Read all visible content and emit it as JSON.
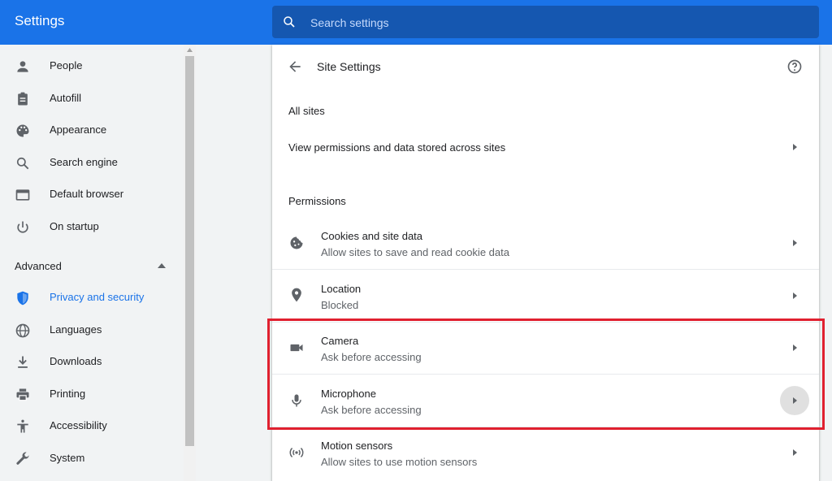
{
  "app": {
    "title": "Settings"
  },
  "search": {
    "placeholder": "Search settings"
  },
  "sidebar": {
    "items": [
      {
        "label": "People",
        "icon": "person-icon"
      },
      {
        "label": "Autofill",
        "icon": "clipboard-icon"
      },
      {
        "label": "Appearance",
        "icon": "palette-icon"
      },
      {
        "label": "Search engine",
        "icon": "search-icon"
      },
      {
        "label": "Default browser",
        "icon": "browser-window-icon"
      },
      {
        "label": "On startup",
        "icon": "power-icon"
      }
    ],
    "advanced_label": "Advanced",
    "advanced_items": [
      {
        "label": "Privacy and security",
        "icon": "shield-icon",
        "active": true
      },
      {
        "label": "Languages",
        "icon": "globe-icon"
      },
      {
        "label": "Downloads",
        "icon": "download-icon"
      },
      {
        "label": "Printing",
        "icon": "printer-icon"
      },
      {
        "label": "Accessibility",
        "icon": "accessibility-icon"
      },
      {
        "label": "System",
        "icon": "wrench-icon"
      }
    ]
  },
  "main": {
    "title": "Site Settings",
    "all_sites_header": "All sites",
    "all_sites_row": "View permissions and data stored across sites",
    "permissions_header": "Permissions",
    "permissions": [
      {
        "title": "Cookies and site data",
        "subtitle": "Allow sites to save and read cookie data",
        "icon": "cookie-icon"
      },
      {
        "title": "Location",
        "subtitle": "Blocked",
        "icon": "location-pin-icon"
      },
      {
        "title": "Camera",
        "subtitle": "Ask before accessing",
        "icon": "camera-icon"
      },
      {
        "title": "Microphone",
        "subtitle": "Ask before accessing",
        "icon": "microphone-icon"
      },
      {
        "title": "Motion sensors",
        "subtitle": "Allow sites to use motion sensors",
        "icon": "motion-sensors-icon"
      }
    ]
  },
  "colors": {
    "accent": "#1a73e8",
    "search_bg": "#1557b0",
    "highlight": "#e0202f"
  }
}
